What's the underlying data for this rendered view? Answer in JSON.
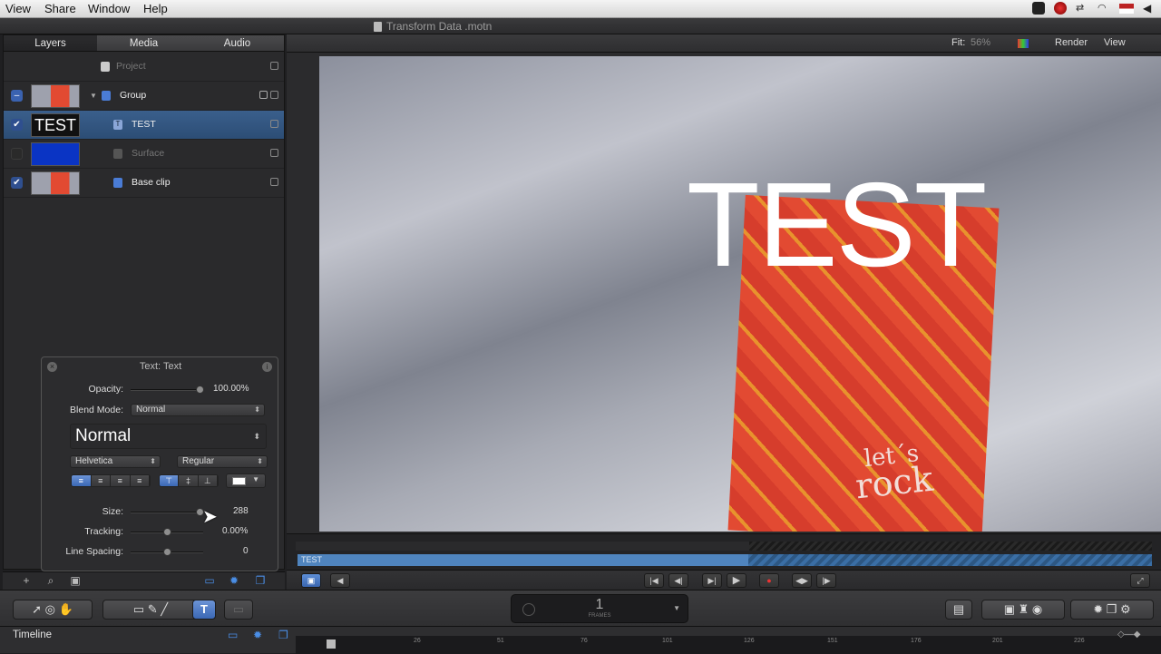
{
  "menubar": {
    "items": [
      "View",
      "Share",
      "Window",
      "Help"
    ]
  },
  "window": {
    "title": "Transform Data .motn"
  },
  "layers_panel": {
    "tabs": [
      "Layers",
      "Media",
      "Audio"
    ],
    "project_label": "Project",
    "rows": [
      {
        "name": "Group",
        "checked": "indeterminate"
      },
      {
        "name": "TEST",
        "checked": true,
        "thumb_text": "TEST"
      },
      {
        "name": "Surface",
        "checked": false
      },
      {
        "name": "Base clip",
        "checked": true
      }
    ]
  },
  "hud": {
    "title": "Text: Text",
    "opacity_label": "Opacity:",
    "opacity_value": "100.00%",
    "opacity_level": 1.0,
    "blend_label": "Blend Mode:",
    "blend_value": "Normal",
    "style_preset": "Normal",
    "font_family": "Helvetica",
    "font_style": "Regular",
    "size_label": "Size:",
    "size_value": "288",
    "tracking_label": "Tracking:",
    "tracking_value": "0.00%",
    "line_spacing_label": "Line Spacing:",
    "line_spacing_value": "0",
    "text_color": "#ffffff"
  },
  "viewer": {
    "fit_label": "Fit:",
    "fit_value": "56%",
    "render_label": "Render",
    "view_label": "View",
    "overlay_text": "TEST",
    "card_line1": "let´s",
    "card_line2": "rock"
  },
  "mini_timeline": {
    "track_label": "TEST"
  },
  "toolbar": {
    "counter_value": "1",
    "counter_unit": "FRAMES"
  },
  "timeline": {
    "label": "Timeline",
    "ticks": [
      "26",
      "51",
      "76",
      "101",
      "126",
      "151",
      "176",
      "201",
      "226"
    ]
  },
  "colors": {
    "selection": "#2c4d75",
    "accent": "#3b68b5",
    "card_red": "#e24a32"
  }
}
